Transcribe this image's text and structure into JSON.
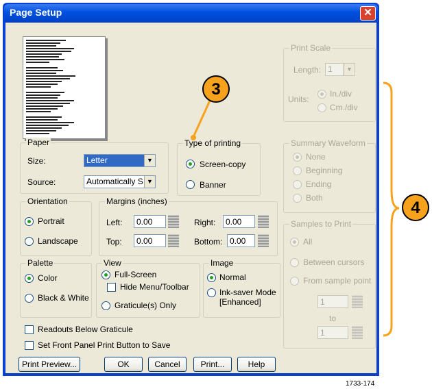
{
  "title": "Page Setup",
  "close_glyph": "✕",
  "paper": {
    "group_label": "Paper",
    "size_label": "Size:",
    "size_value": "Letter",
    "source_label": "Source:",
    "source_value": "Automatically S"
  },
  "type_of_printing": {
    "group_label": "Type of printing",
    "screen_copy": "Screen-copy",
    "banner": "Banner"
  },
  "print_scale": {
    "group_label": "Print Scale",
    "length_label": "Length:",
    "length_value": "1",
    "units_label": "Units:",
    "in_div": "In./div",
    "cm_div": "Cm./div"
  },
  "summary_waveform": {
    "group_label": "Summary Waveform",
    "none": "None",
    "beginning": "Beginning",
    "ending": "Ending",
    "both": "Both"
  },
  "samples_to_print": {
    "group_label": "Samples to Print",
    "all": "All",
    "between_cursors": "Between cursors",
    "from_sample_point": "From sample point",
    "from_value": "1",
    "to_label": "to",
    "to_value": "1"
  },
  "orientation": {
    "group_label": "Orientation",
    "portrait": "Portrait",
    "landscape": "Landscape"
  },
  "margins": {
    "group_label": "Margins (inches)",
    "left_label": "Left:",
    "left_value": "0.00",
    "right_label": "Right:",
    "right_value": "0.00",
    "top_label": "Top:",
    "top_value": "0.00",
    "bottom_label": "Bottom:",
    "bottom_value": "0.00"
  },
  "palette": {
    "group_label": "Palette",
    "color": "Color",
    "black_white": "Black & White"
  },
  "view": {
    "group_label": "View",
    "full_screen": "Full-Screen",
    "hide_menu_toolbar": "Hide Menu/Toolbar",
    "graticules_only": "Graticule(s) Only"
  },
  "image": {
    "group_label": "Image",
    "normal": "Normal",
    "ink_saver_line1": "Ink-saver Mode",
    "ink_saver_line2": "[Enhanced]"
  },
  "checkboxes": {
    "readouts_below": "Readouts Below Graticule",
    "front_panel": "Set Front Panel Print Button to Save"
  },
  "buttons": {
    "print_preview": "Print Preview...",
    "ok": "OK",
    "cancel": "Cancel",
    "print": "Print...",
    "help": "Help"
  },
  "callouts": {
    "three": "3",
    "four": "4"
  },
  "figure_id": "1733-174",
  "colors": {
    "title_bar": "#0050e0",
    "dialog_face": "#ece9d8",
    "callout": "#f6a21d",
    "bracket": "#f6a21d"
  }
}
